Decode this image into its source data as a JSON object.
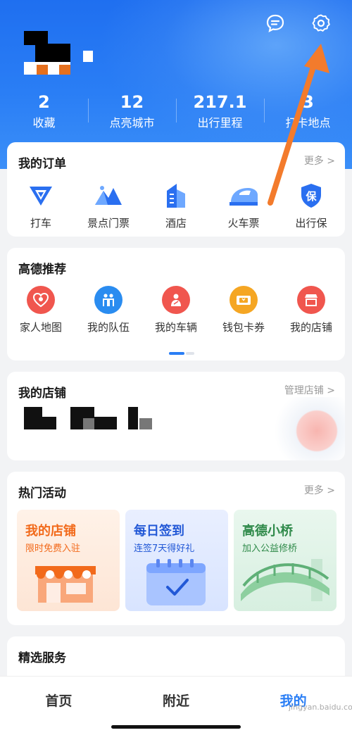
{
  "header": {
    "stats": [
      {
        "value": "2",
        "label": "收藏"
      },
      {
        "value": "12",
        "label": "点亮城市"
      },
      {
        "value": "217.1",
        "label": "出行里程"
      },
      {
        "value": "3",
        "label": "打卡地点"
      }
    ]
  },
  "orders": {
    "title": "我的订单",
    "more": "更多 >",
    "items": [
      {
        "label": "打车",
        "icon": "taxi-icon"
      },
      {
        "label": "景点门票",
        "icon": "mountain-ticket-icon"
      },
      {
        "label": "酒店",
        "icon": "hotel-building-icon"
      },
      {
        "label": "火车票",
        "icon": "train-icon"
      },
      {
        "label": "出行保",
        "icon": "insurance-shield-icon"
      }
    ]
  },
  "recommend": {
    "title": "高德推荐",
    "items": [
      {
        "label": "家人地图",
        "icon": "family-map-icon",
        "color": "#f0564e"
      },
      {
        "label": "我的队伍",
        "icon": "team-icon",
        "color": "#2a8cf0"
      },
      {
        "label": "我的车辆",
        "icon": "vehicle-icon",
        "color": "#f0564e"
      },
      {
        "label": "钱包卡券",
        "icon": "wallet-coupon-icon",
        "color": "#f5a623"
      },
      {
        "label": "我的店铺",
        "icon": "store-icon",
        "color": "#f0564e"
      }
    ]
  },
  "store": {
    "title": "我的店铺",
    "manage": "管理店铺 >"
  },
  "activities": {
    "title": "热门活动",
    "more": "更多 >",
    "items": [
      {
        "title": "我的店铺",
        "subtitle": "限时免费入驻",
        "color": "#f26a1b"
      },
      {
        "title": "每日签到",
        "subtitle": "连签7天得好礼",
        "color": "#2258d6"
      },
      {
        "title": "高德小桥",
        "subtitle": "加入公益修桥",
        "color": "#2f8a4a"
      }
    ]
  },
  "services": {
    "title": "精选服务"
  },
  "tabbar": {
    "tabs": [
      {
        "label": "首页"
      },
      {
        "label": "附近"
      },
      {
        "label": "我的"
      }
    ]
  },
  "watermark": "jingyan.baidu.com",
  "colors": {
    "accent": "#2a7ef5",
    "annotation_arrow": "#f37b2c"
  }
}
